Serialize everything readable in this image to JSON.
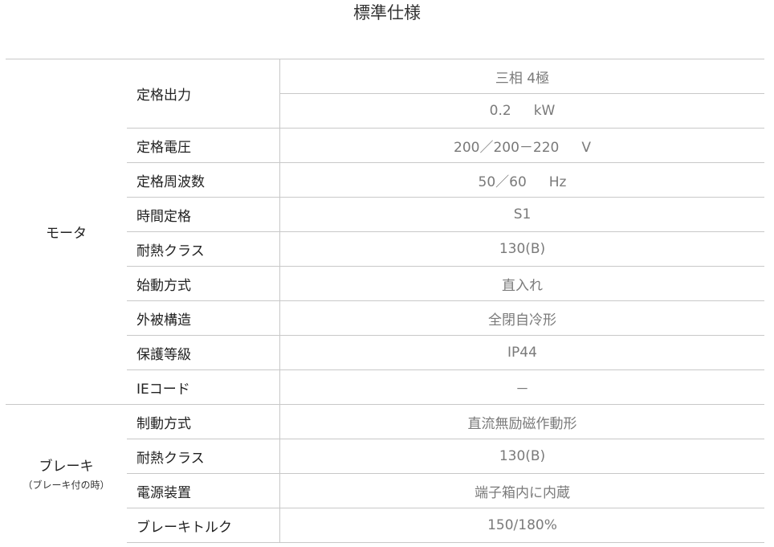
{
  "title": "標準仕様",
  "motor": {
    "group_label": "モータ",
    "rows": [
      {
        "label": "定格出力",
        "value": "三相 4極"
      },
      {
        "label": "",
        "value": "0.2",
        "unit": "kW"
      },
      {
        "label": "定格電圧",
        "value": "200／200－220",
        "unit": "V"
      },
      {
        "label": "定格周波数",
        "value": "50／60",
        "unit": "Hz"
      },
      {
        "label": "時間定格",
        "value": "S1"
      },
      {
        "label": "耐熱クラス",
        "value": "130(B)"
      },
      {
        "label": "始動方式",
        "value": "直入れ"
      },
      {
        "label": "外被構造",
        "value": "全閉自冷形"
      },
      {
        "label": "保護等級",
        "value": "IP44"
      },
      {
        "label": "IEコード",
        "value": "－"
      }
    ]
  },
  "brake": {
    "group_label": "ブレーキ",
    "group_sub": "（ブレーキ付の時）",
    "rows": [
      {
        "label": "制動方式",
        "value": "直流無励磁作動形"
      },
      {
        "label": "耐熱クラス",
        "value": "130(B)"
      },
      {
        "label": "電源装置",
        "value": "端子箱内に内蔵"
      },
      {
        "label": "ブレーキトルク",
        "value": "150/180%"
      }
    ]
  }
}
